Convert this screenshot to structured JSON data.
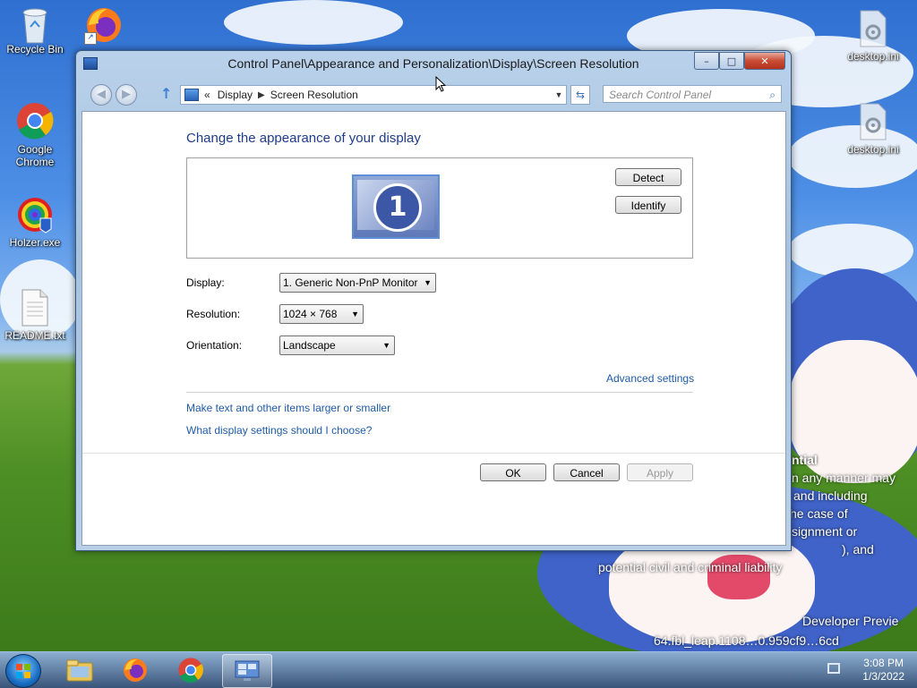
{
  "desktop": {
    "icons_left": [
      {
        "label": "Recycle Bin",
        "icon": "recycle-bin-icon"
      },
      {
        "label": "Google Chrome",
        "icon": "chrome-icon"
      },
      {
        "label": "Holzer.exe",
        "icon": "holzer-icon"
      },
      {
        "label": "README.txt",
        "icon": "text-file-icon"
      }
    ],
    "icons_right": [
      {
        "label": "desktop.ini",
        "icon": "settings-file-icon"
      },
      {
        "label": "desktop.ini",
        "icon": "settings-file-icon"
      }
    ],
    "firefox_shortcut": "firefox-icon",
    "watermark": {
      "line1": "ntial",
      "line2": "n any manner may",
      "line3": "and including",
      "line4": "he case of",
      "line5": "signment or",
      "line6": "), and",
      "line7": "potential civil and criminal liability",
      "line8": "Developer Previe",
      "line9": "64.fbl_leap.1108…0.959cf9…6cd"
    }
  },
  "window": {
    "title": "Control Panel\\Appearance and Personalization\\Display\\Screen Resolution",
    "controls": {
      "minimize": "–",
      "maximize": "□",
      "close": "✕"
    },
    "nav": {
      "back": "◀",
      "forward": "▶",
      "up": "↑",
      "breadcrumb_prefix": "«",
      "breadcrumb": [
        "Display",
        "Screen Resolution"
      ],
      "breadcrumb_sep": "▶",
      "dropdown": "▼",
      "refresh": "⇆",
      "search_placeholder": "Search Control Panel",
      "search_icon": "⌕"
    },
    "content": {
      "heading": "Change the appearance of your display",
      "monitor_number": "1",
      "detect": "Detect",
      "identify": "Identify",
      "display_label": "Display:",
      "display_value": "1. Generic Non-PnP Monitor",
      "resolution_label": "Resolution:",
      "resolution_value": "1024 × 768",
      "orientation_label": "Orientation:",
      "orientation_value": "Landscape",
      "dropdown_arrow": "▼",
      "advanced_link": "Advanced settings",
      "link_text_size": "Make text and other items larger or smaller",
      "link_help": "What display settings should I choose?",
      "ok": "OK",
      "cancel": "Cancel",
      "apply": "Apply"
    }
  },
  "taskbar": {
    "items": [
      "file-explorer-icon",
      "firefox-icon",
      "chrome-icon",
      "display-settings-icon"
    ],
    "active_item": "display-settings-icon",
    "time": "3:08 PM",
    "date": "1/3/2022"
  }
}
